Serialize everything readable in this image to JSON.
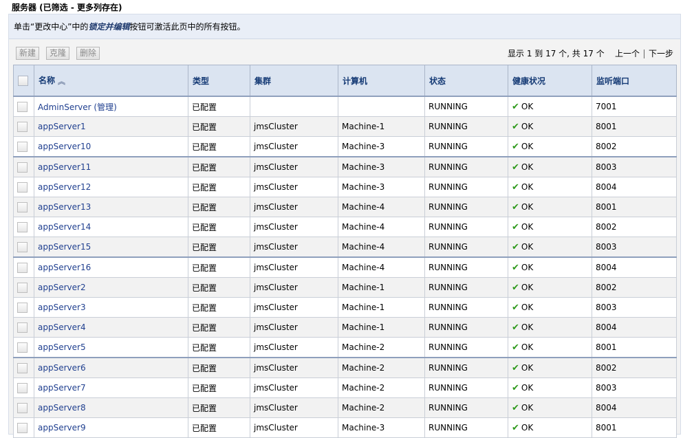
{
  "page": {
    "title": "服务器 (已筛选 - 更多列存在)",
    "info_prefix": "单击“更改中心”中的",
    "info_emphasis": "锁定并编辑",
    "info_suffix": "按钮可激活此页中的所有按钮。"
  },
  "toolbar": {
    "new_label": "新建",
    "clone_label": "克隆",
    "delete_label": "删除"
  },
  "pager": {
    "summary": "显示 1 到 17 个, 共 17 个",
    "prev_label": "上一个",
    "next_label": "下一步"
  },
  "table": {
    "headers": {
      "name": "名称",
      "type": "类型",
      "cluster": "集群",
      "machine": "计算机",
      "state": "状态",
      "health": "健康状况",
      "port": "监听端口"
    },
    "sort_icon": "sort-ascending-icon",
    "health_icon": "check-icon",
    "health_color": "#2f9a1d",
    "rows": [
      {
        "name": "AdminServer (管理)",
        "type": "已配置",
        "cluster": "",
        "machine": "",
        "state": "RUNNING",
        "health": "OK",
        "port": "7001"
      },
      {
        "name": "appServer1",
        "type": "已配置",
        "cluster": "jmsCluster",
        "machine": "Machine-1",
        "state": "RUNNING",
        "health": "OK",
        "port": "8001"
      },
      {
        "name": "appServer10",
        "type": "已配置",
        "cluster": "jmsCluster",
        "machine": "Machine-3",
        "state": "RUNNING",
        "health": "OK",
        "port": "8002"
      },
      {
        "name": "appServer11",
        "type": "已配置",
        "cluster": "jmsCluster",
        "machine": "Machine-3",
        "state": "RUNNING",
        "health": "OK",
        "port": "8003"
      },
      {
        "name": "appServer12",
        "type": "已配置",
        "cluster": "jmsCluster",
        "machine": "Machine-3",
        "state": "RUNNING",
        "health": "OK",
        "port": "8004"
      },
      {
        "name": "appServer13",
        "type": "已配置",
        "cluster": "jmsCluster",
        "machine": "Machine-4",
        "state": "RUNNING",
        "health": "OK",
        "port": "8001"
      },
      {
        "name": "appServer14",
        "type": "已配置",
        "cluster": "jmsCluster",
        "machine": "Machine-4",
        "state": "RUNNING",
        "health": "OK",
        "port": "8002"
      },
      {
        "name": "appServer15",
        "type": "已配置",
        "cluster": "jmsCluster",
        "machine": "Machine-4",
        "state": "RUNNING",
        "health": "OK",
        "port": "8003"
      },
      {
        "name": "appServer16",
        "type": "已配置",
        "cluster": "jmsCluster",
        "machine": "Machine-4",
        "state": "RUNNING",
        "health": "OK",
        "port": "8004"
      },
      {
        "name": "appServer2",
        "type": "已配置",
        "cluster": "jmsCluster",
        "machine": "Machine-1",
        "state": "RUNNING",
        "health": "OK",
        "port": "8002"
      },
      {
        "name": "appServer3",
        "type": "已配置",
        "cluster": "jmsCluster",
        "machine": "Machine-1",
        "state": "RUNNING",
        "health": "OK",
        "port": "8003"
      },
      {
        "name": "appServer4",
        "type": "已配置",
        "cluster": "jmsCluster",
        "machine": "Machine-1",
        "state": "RUNNING",
        "health": "OK",
        "port": "8004"
      },
      {
        "name": "appServer5",
        "type": "已配置",
        "cluster": "jmsCluster",
        "machine": "Machine-2",
        "state": "RUNNING",
        "health": "OK",
        "port": "8001"
      },
      {
        "name": "appServer6",
        "type": "已配置",
        "cluster": "jmsCluster",
        "machine": "Machine-2",
        "state": "RUNNING",
        "health": "OK",
        "port": "8002"
      },
      {
        "name": "appServer7",
        "type": "已配置",
        "cluster": "jmsCluster",
        "machine": "Machine-2",
        "state": "RUNNING",
        "health": "OK",
        "port": "8003"
      },
      {
        "name": "appServer8",
        "type": "已配置",
        "cluster": "jmsCluster",
        "machine": "Machine-2",
        "state": "RUNNING",
        "health": "OK",
        "port": "8004"
      },
      {
        "name": "appServer9",
        "type": "已配置",
        "cluster": "jmsCluster",
        "machine": "Machine-3",
        "state": "RUNNING",
        "health": "OK",
        "port": "8001"
      }
    ]
  }
}
